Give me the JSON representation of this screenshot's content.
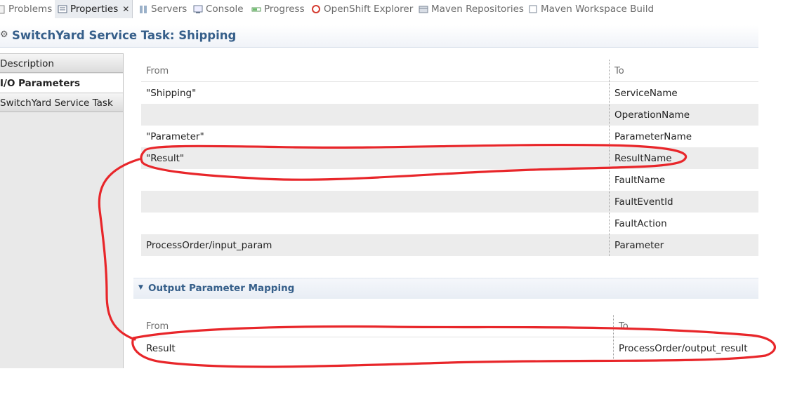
{
  "tabs": [
    {
      "label": "Problems",
      "icon": "problems-icon"
    },
    {
      "label": "Properties",
      "icon": "properties-icon",
      "active": true
    },
    {
      "label": "Servers",
      "icon": "servers-icon"
    },
    {
      "label": "Console",
      "icon": "console-icon"
    },
    {
      "label": "Progress",
      "icon": "progress-icon"
    },
    {
      "label": "OpenShift Explorer",
      "icon": "openshift-icon"
    },
    {
      "label": "Maven Repositories",
      "icon": "maven-repo-icon"
    },
    {
      "label": "Maven Workspace Build",
      "icon": "maven-build-icon"
    }
  ],
  "form": {
    "title": "SwitchYard Service Task: Shipping"
  },
  "sidebar": {
    "items": [
      {
        "label": "Description"
      },
      {
        "label": "I/O Parameters",
        "selected": true
      },
      {
        "label": "SwitchYard Service Task"
      }
    ]
  },
  "input_table": {
    "headers": {
      "from": "From",
      "to": "To"
    },
    "rows": [
      {
        "from": "\"Shipping\"",
        "to": "ServiceName"
      },
      {
        "from": "",
        "to": "OperationName"
      },
      {
        "from": "\"Parameter\"",
        "to": "ParameterName"
      },
      {
        "from": "\"Result\"",
        "to": "ResultName"
      },
      {
        "from": "",
        "to": "FaultName"
      },
      {
        "from": "",
        "to": "FaultEventId"
      },
      {
        "from": "",
        "to": "FaultAction"
      },
      {
        "from": "ProcessOrder/input_param",
        "to": "Parameter"
      }
    ]
  },
  "output_section": {
    "title": "Output Parameter Mapping"
  },
  "output_table": {
    "headers": {
      "from": "From",
      "to": "To"
    },
    "rows": [
      {
        "from": "Result",
        "to": "ProcessOrder/output_result"
      }
    ]
  },
  "colors": {
    "accent": "#365f8a",
    "annotation": "#e8262a",
    "alt_row": "#ececec"
  }
}
